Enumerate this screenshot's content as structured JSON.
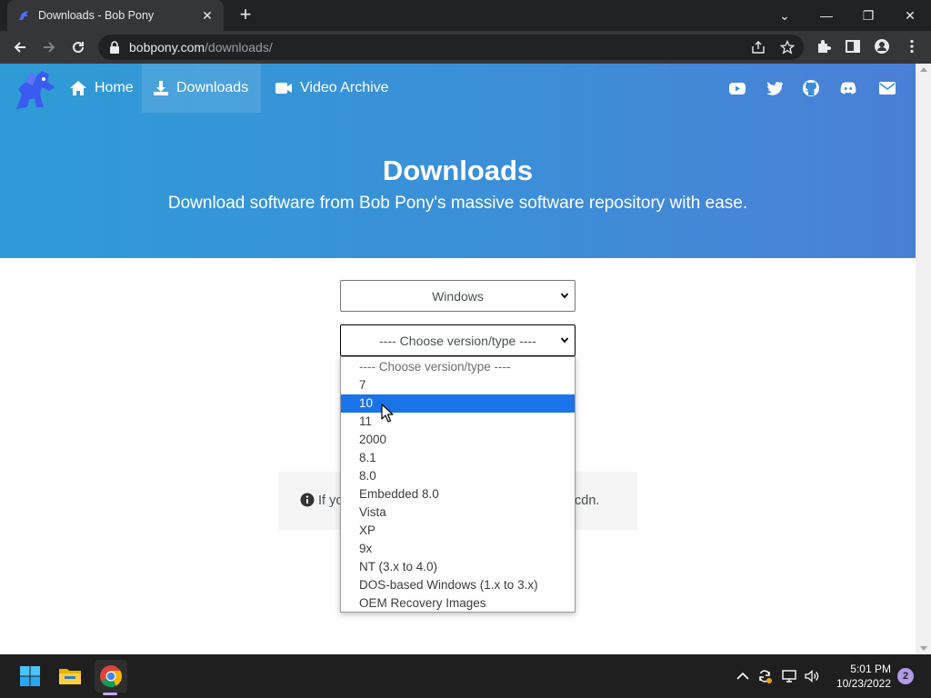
{
  "browser": {
    "tab_title": "Downloads - Bob Pony",
    "tab_close": "✕",
    "new_tab": "+",
    "window_controls": {
      "dropdown": "⌄",
      "minimize": "—",
      "restore": "❐",
      "close": "✕"
    },
    "url_host": "bobpony.com",
    "url_path": "/downloads/"
  },
  "site": {
    "nav": {
      "items": [
        {
          "label": "Home",
          "icon": "home-icon"
        },
        {
          "label": "Downloads",
          "icon": "download-icon",
          "active": true
        },
        {
          "label": "Video Archive",
          "icon": "video-camera-icon"
        }
      ],
      "social": [
        "youtube-icon",
        "twitter-icon",
        "github-icon",
        "discord-icon",
        "email-icon"
      ]
    },
    "hero": {
      "title": "Downloads",
      "subtitle": "Download software from Bob Pony's massive software repository with ease."
    },
    "os_select": {
      "value": "Windows"
    },
    "version_select": {
      "value": "---- Choose version/type ----",
      "options": [
        "---- Choose version/type ----",
        "7",
        "10",
        "11",
        "2000",
        "8.1",
        "8.0",
        "Embedded 8.0",
        "Vista",
        "XP",
        "9x",
        "NT (3.x to 4.0)",
        "DOS-based Windows (1.x to 3.x)",
        "OEM Recovery Images"
      ],
      "highlighted_index": 2
    },
    "notice": {
      "text_start": "If yo",
      "text_end": "cdn."
    }
  },
  "taskbar": {
    "apps": [
      "windows-start-icon",
      "file-explorer-icon",
      "chrome-icon"
    ],
    "clock_time": "5:01 PM",
    "clock_date": "10/23/2022",
    "notification_count": "2"
  },
  "colors": {
    "hero_gradient_start": "#2e9bd6",
    "hero_gradient_end": "#4a7fd6",
    "highlight": "#1a73e8"
  }
}
